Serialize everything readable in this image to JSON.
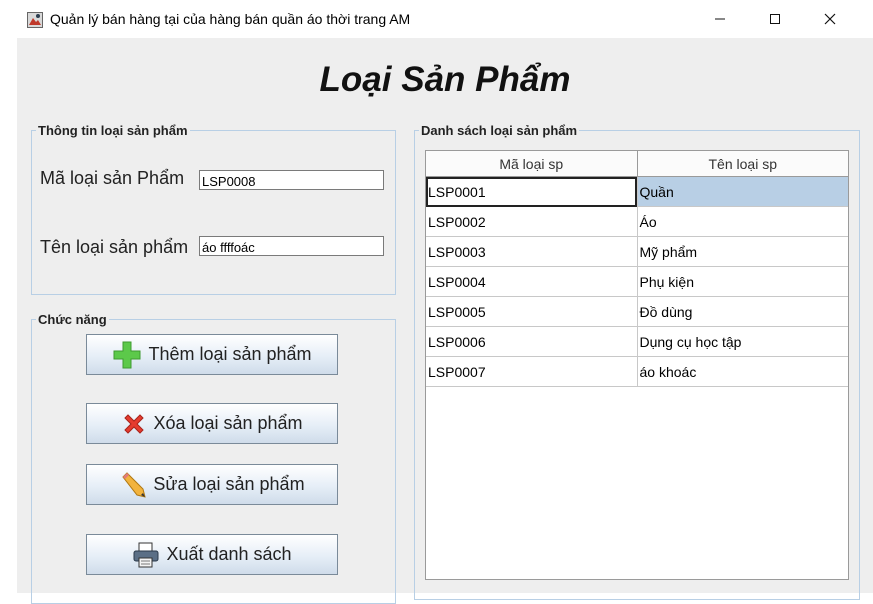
{
  "window": {
    "title": "Quản lý bán hàng tại của hàng bán quần áo thời trang AM",
    "icon": "app-icon"
  },
  "heading": "Loại Sản Phẩm",
  "info_group": {
    "legend": "Thông tin loại sản phẩm",
    "code_label": "Mã loại sản Phẩm",
    "code_value": "LSP0008",
    "name_label": "Tên loại sản phẩm",
    "name_value": "áo ffffoác"
  },
  "function_group": {
    "legend": "Chức năng",
    "buttons": [
      {
        "label": "Thêm loại sản phẩm",
        "icon": "plus-icon"
      },
      {
        "label": "Xóa loại sản phẩm",
        "icon": "delete-x-icon"
      },
      {
        "label": "Sửa loại sản phẩm",
        "icon": "pencil-icon"
      },
      {
        "label": "Xuất danh sách",
        "icon": "printer-icon"
      }
    ]
  },
  "list_group": {
    "legend": "Danh sách loại sản phẩm",
    "columns": [
      "Mã loại sp",
      "Tên loại sp"
    ],
    "rows": [
      [
        "LSP0001",
        "Quần"
      ],
      [
        "LSP0002",
        "Áo"
      ],
      [
        "LSP0003",
        "Mỹ phẩm"
      ],
      [
        "LSP0004",
        "Phụ kiện"
      ],
      [
        "LSP0005",
        "Đồ dùng"
      ],
      [
        "LSP0006",
        "Dụng cụ học tập"
      ],
      [
        "LSP0007",
        "áo khoác"
      ]
    ],
    "selected_row": 0
  },
  "colors": {
    "window_bg": "#eeeeee",
    "group_border": "#b8cfe5",
    "selection": "#b8cfe5",
    "plus_green": "#5cc94a",
    "delete_red": "#e53b2f"
  }
}
